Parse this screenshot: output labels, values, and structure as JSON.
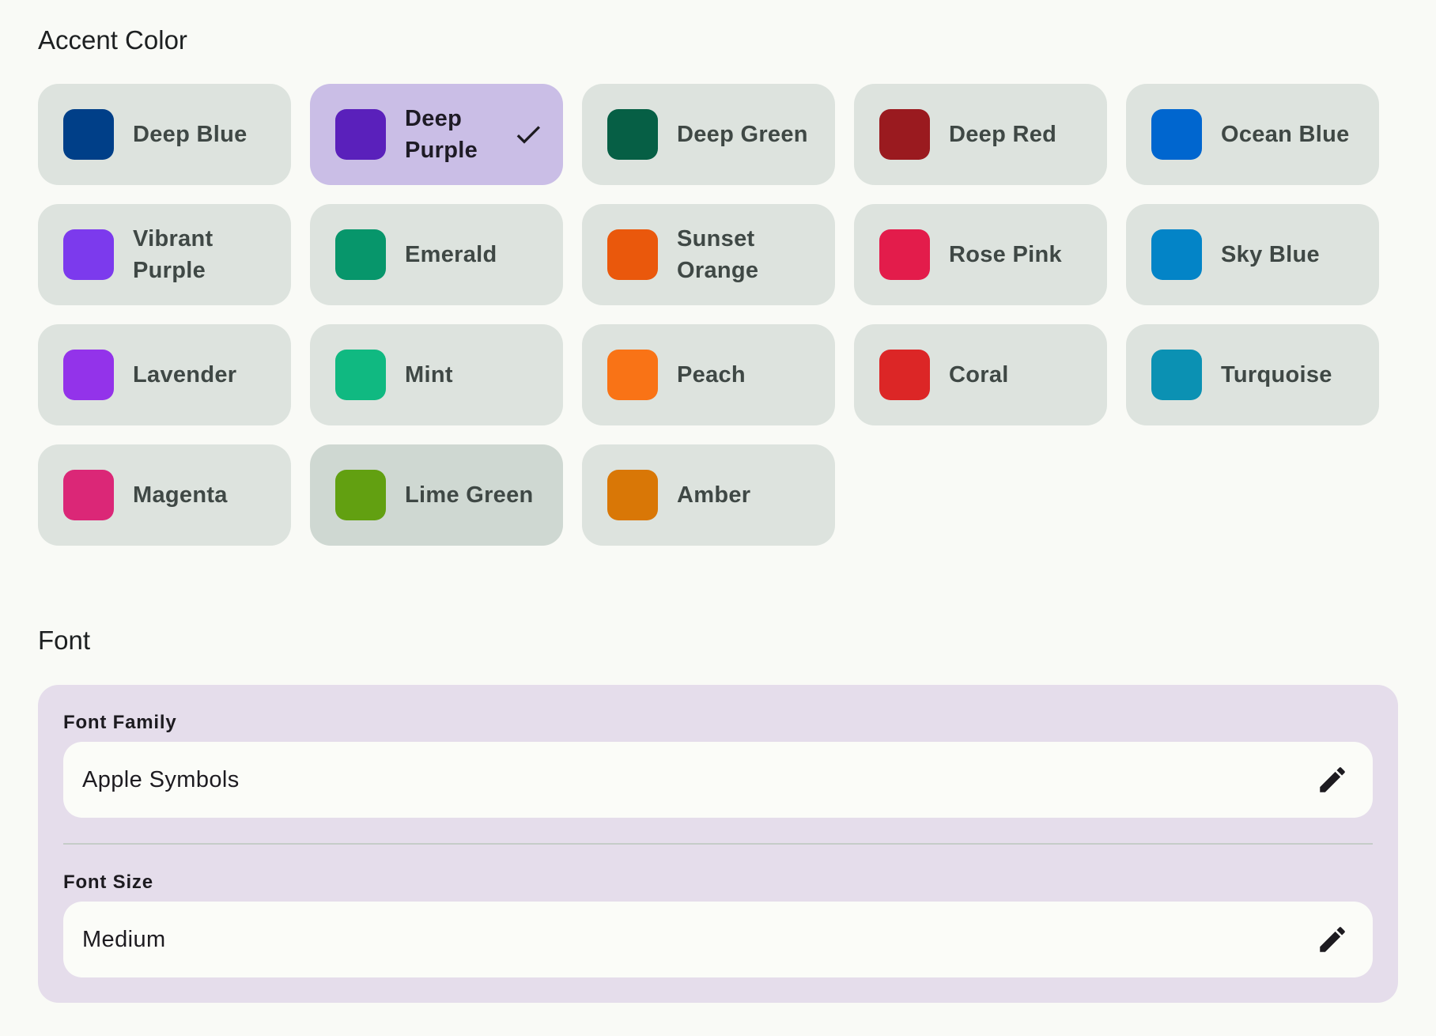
{
  "accent_section": {
    "title": "Accent Color",
    "rows": [
      [
        {
          "label": "Deep Blue",
          "color": "#003f88",
          "selected": false
        },
        {
          "label": "Deep Purple",
          "color": "#5a20bb",
          "selected": true
        },
        {
          "label": "Deep Green",
          "color": "#065f45",
          "selected": false
        },
        {
          "label": "Deep Red",
          "color": "#9a1a1f",
          "selected": false
        },
        {
          "label": "Ocean Blue",
          "color": "#0066cf",
          "selected": false
        }
      ],
      [
        {
          "label": "Vibrant Purple",
          "color": "#7c3aed",
          "selected": false
        },
        {
          "label": "Emerald",
          "color": "#07966b",
          "selected": false
        },
        {
          "label": "Sunset Orange",
          "color": "#ea580c",
          "selected": false
        },
        {
          "label": "Rose Pink",
          "color": "#e31c4b",
          "selected": false
        },
        {
          "label": "Sky Blue",
          "color": "#0384c7",
          "selected": false
        }
      ],
      [
        {
          "label": "Lavender",
          "color": "#9333ea",
          "selected": false
        },
        {
          "label": "Mint",
          "color": "#10b981",
          "selected": false
        },
        {
          "label": "Peach",
          "color": "#f97316",
          "selected": false
        },
        {
          "label": "Coral",
          "color": "#dc2626",
          "selected": false
        },
        {
          "label": "Turquoise",
          "color": "#0b91b3",
          "selected": false
        }
      ],
      [
        {
          "label": "Magenta",
          "color": "#db2777",
          "selected": false
        },
        {
          "label": "Lime Green",
          "color": "#62a011",
          "selected": false,
          "hovered": true
        },
        {
          "label": "Amber",
          "color": "#d97706",
          "selected": false
        }
      ]
    ]
  },
  "font_section": {
    "title": "Font",
    "font_family": {
      "label": "Font Family",
      "value": "Apple Symbols",
      "icon": "edit-pencil-icon"
    },
    "font_size": {
      "label": "Font Size",
      "value": "Medium",
      "icon": "edit-pencil-icon"
    }
  },
  "icons": {
    "selected_marker": "checkmark-icon"
  }
}
